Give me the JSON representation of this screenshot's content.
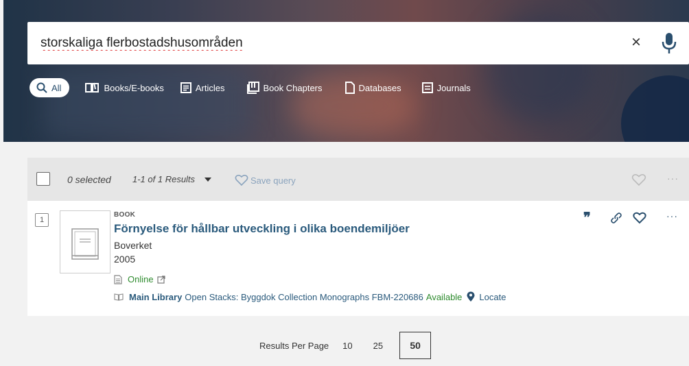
{
  "search": {
    "query": "storskaliga flerbostadshusområden",
    "clear_glyph": "×",
    "mic_icon": "microphone-icon",
    "search_icon": "magnifier-icon"
  },
  "tabs": [
    {
      "label": "All",
      "icon": "search-icon",
      "active": true
    },
    {
      "label": "Books/E-books",
      "icon": "open-book-icon"
    },
    {
      "label": "Articles",
      "icon": "article-icon"
    },
    {
      "label": "Book Chapters",
      "icon": "book-chapter-icon"
    },
    {
      "label": "Databases",
      "icon": "file-icon"
    },
    {
      "label": "Journals",
      "icon": "journal-icon"
    }
  ],
  "toolbar": {
    "selected": "0 selected",
    "results": "1-1 of 1 Results",
    "save_query": "Save query",
    "more": "···"
  },
  "result": {
    "rank": "1",
    "type": "BOOK",
    "title": "Förnyelse för hållbar utveckling i olika boendemiljöer",
    "creator": "Boverket",
    "year": "2005",
    "online": "Online",
    "library": "Main Library",
    "location": "Open Stacks: Byggdok Collection Monographs FBM-220686",
    "availability": "Available",
    "locate": "Locate",
    "cite_glyph": "❞",
    "more": "···"
  },
  "pagination": {
    "label": "Results Per Page",
    "options": [
      "10",
      "25",
      "50"
    ],
    "selected": "50"
  },
  "colors": {
    "primary": "#2a5a7c",
    "available": "#2e8b2e",
    "search_green": "#2e8b2e",
    "mic_blue": "#2a4f6e"
  }
}
